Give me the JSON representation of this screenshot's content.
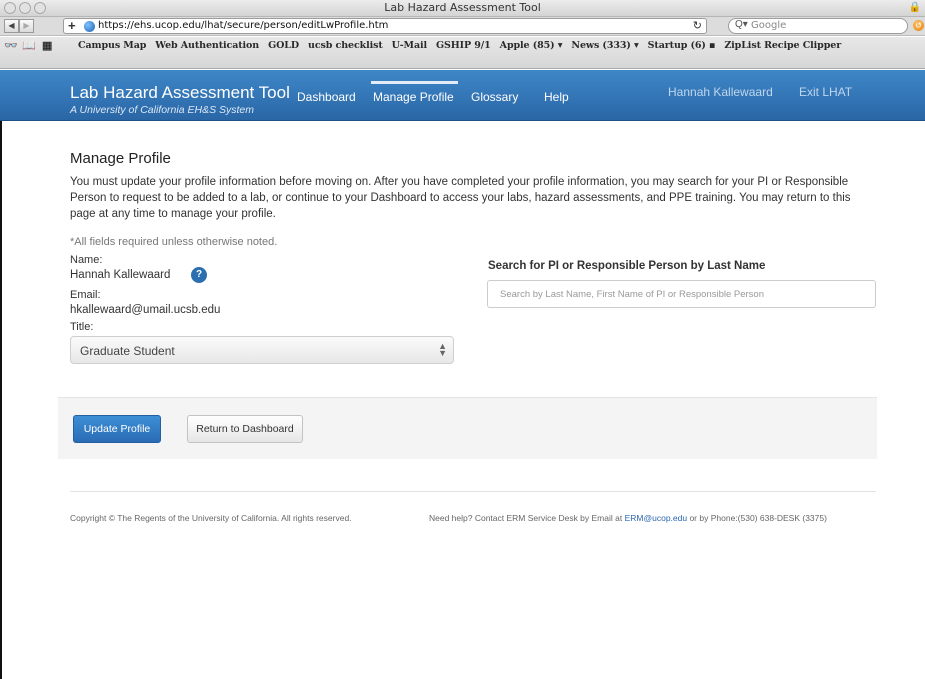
{
  "window": {
    "title": "Lab Hazard Assessment Tool",
    "url": "https://ehs.ucop.edu/lhat/secure/person/editLwProfile.htm",
    "search_placeholder": "Google"
  },
  "bookmarks": [
    "Campus Map",
    "Web Authentication",
    "GOLD",
    "ucsb checklist",
    "U-Mail",
    "GSHIP 9/1",
    "Apple (85) ▾",
    "News (333) ▾",
    "Startup (6) ▪",
    "ZipList Recipe Clipper"
  ],
  "header": {
    "title": "Lab Hazard Assessment Tool",
    "subtitle": "A University of California EH&S System",
    "nav": {
      "dashboard": "Dashboard",
      "manage_profile": "Manage Profile",
      "glossary": "Glossary",
      "help": "Help"
    },
    "user_name": "Hannah Kallewaard",
    "exit": "Exit LHAT"
  },
  "main": {
    "title": "Manage Profile",
    "intro": "You must update your profile information before moving on. After you have completed your profile information, you may search for your PI or Responsible Person to request to be added to a lab, or continue to your Dashboard to access your labs, hazard assessments, and PPE training. You may return to this page at any time to manage your profile.",
    "required_note": "*All fields required unless otherwise noted.",
    "name_label": "Name:",
    "name_value": "Hannah Kallewaard",
    "email_label": "Email:",
    "email_value": "hkallewaard@umail.ucsb.edu",
    "title_label": "Title:",
    "title_value": "Graduate Student",
    "search_heading": "Search for PI or Responsible Person by Last Name",
    "search_placeholder": "Search by Last Name, First Name of PI or Responsible Person"
  },
  "actions": {
    "update": "Update Profile",
    "return": "Return to Dashboard"
  },
  "footer": {
    "copyright": "Copyright © The Regents of the University of California. All rights reserved.",
    "help_prefix": "Need help? Contact ERM Service Desk by Email at ",
    "help_email": "ERM@ucop.edu",
    "help_suffix": " or by Phone:(530) 638-DESK (3375)"
  },
  "colors": {
    "header_blue": "#2f70b0",
    "primary_button": "#2a6cb5",
    "link": "#2a67b1"
  }
}
